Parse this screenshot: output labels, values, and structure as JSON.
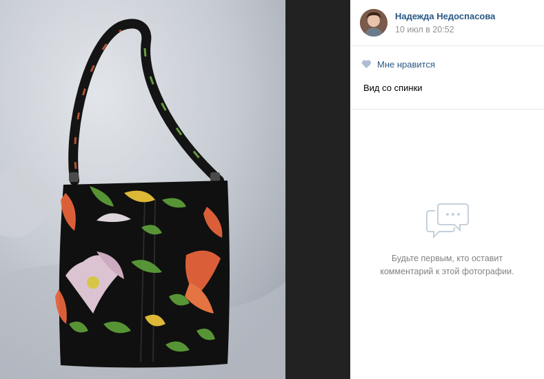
{
  "post": {
    "author_name": "Надежда Недоспасова",
    "date": "10 июл в 20:52",
    "like_label": "Мне нравится",
    "description": "Вид со спинки"
  },
  "comments": {
    "empty_text": "Будьте первым, кто оставит комментарий к этой фотографии."
  },
  "icons": {
    "like": "heart-icon",
    "comments": "comments-bubble-icon"
  },
  "colors": {
    "link": "#2a5885",
    "muted": "#939393",
    "like_heart": "#aebed1",
    "panel_bg": "#ffffff",
    "viewer_bg": "#222222"
  }
}
